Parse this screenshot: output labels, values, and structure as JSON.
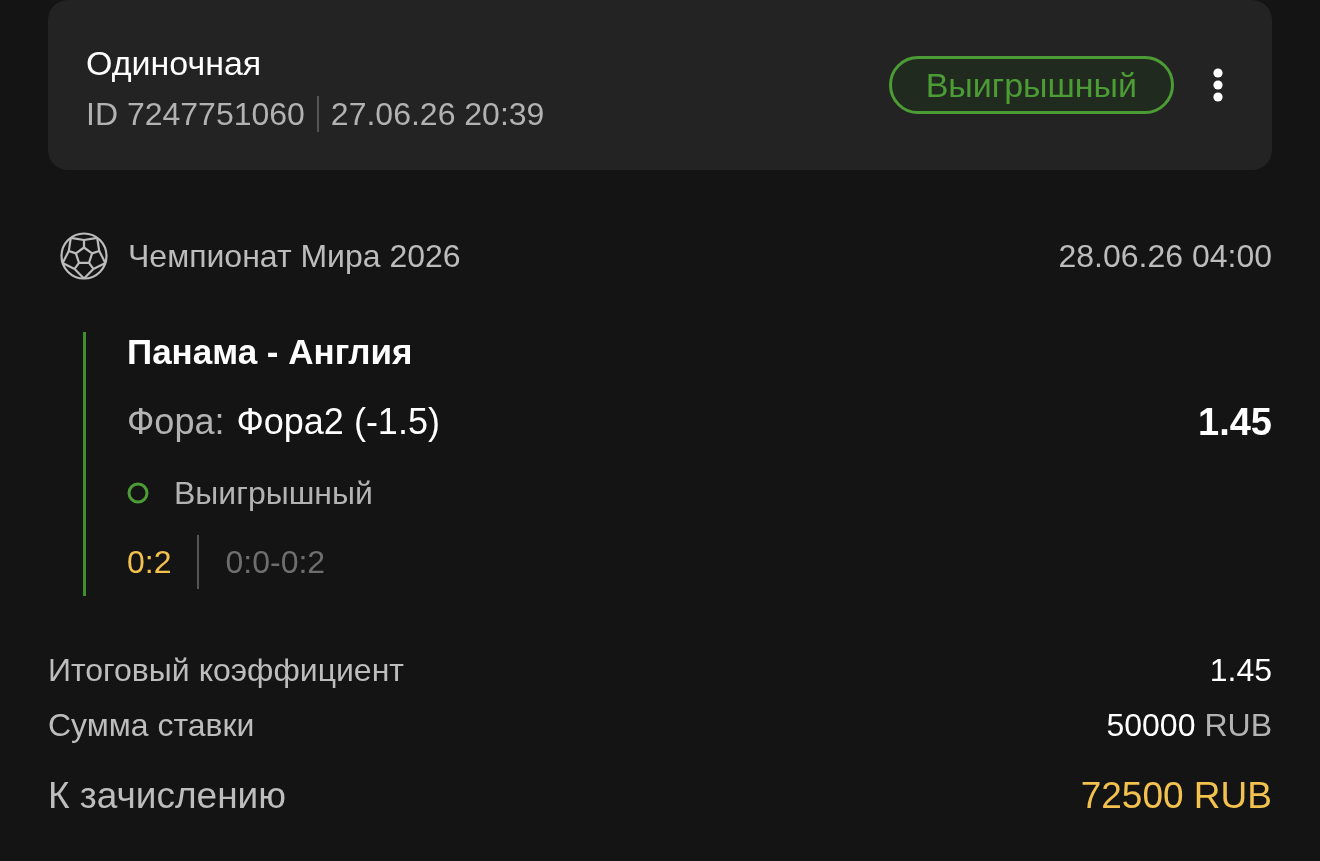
{
  "bet": {
    "type": "Одиночная",
    "id": "ID 7247751060",
    "placed_at": "27.06.26 20:39",
    "status": {
      "label": "Выигрышный",
      "kind": "won"
    }
  },
  "event": {
    "tournament": "Чемпионат Мира 2026",
    "start": "28.06.26 04:00",
    "match": "Панама - Англия",
    "market_label": "Фора:",
    "selection": "Фора2 (-1.5)",
    "odds": "1.45",
    "outcome": {
      "label": "Выигрышный",
      "kind": "won"
    },
    "score": "0:2",
    "periods": "0:0-0:2"
  },
  "summary": [
    {
      "label": "Итоговый коэффициент",
      "value": "1.45",
      "kind": "plain"
    },
    {
      "label": "Сумма ставки",
      "value": "50000",
      "currency": "RUB",
      "kind": "plain"
    },
    {
      "label": "К зачислению",
      "value": "72500 RUB",
      "kind": "payout"
    }
  ]
}
